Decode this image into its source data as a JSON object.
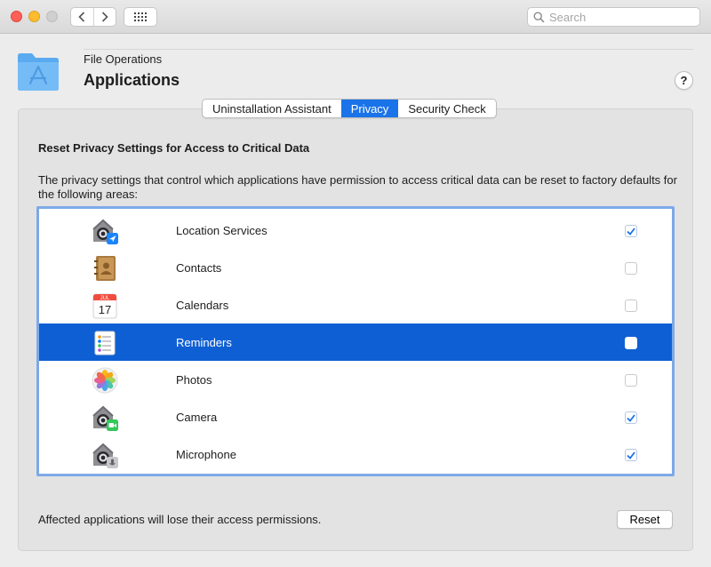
{
  "toolbar": {
    "back_icon": "chevron-left-icon",
    "forward_icon": "chevron-right-icon",
    "grid_icon": "grid-icon",
    "search_placeholder": "Search"
  },
  "header": {
    "breadcrumb": "File Operations",
    "title": "Applications",
    "help_label": "?"
  },
  "tabs": [
    {
      "label": "Uninstallation Assistant",
      "active": false
    },
    {
      "label": "Privacy",
      "active": true
    },
    {
      "label": "Security Check",
      "active": false
    }
  ],
  "privacy": {
    "section_title": "Reset Privacy Settings for Access to Critical Data",
    "description": "The privacy settings that control which applications have permission to access critical data can be reset to factory defaults for the following areas:",
    "items": [
      {
        "label": "Location Services",
        "icon": "location-services-icon",
        "checked": true,
        "selected": false
      },
      {
        "label": "Contacts",
        "icon": "contacts-icon",
        "checked": false,
        "selected": false
      },
      {
        "label": "Calendars",
        "icon": "calendar-icon",
        "checked": false,
        "selected": false
      },
      {
        "label": "Reminders",
        "icon": "reminders-icon",
        "checked": false,
        "selected": true
      },
      {
        "label": "Photos",
        "icon": "photos-icon",
        "checked": false,
        "selected": false
      },
      {
        "label": "Camera",
        "icon": "camera-icon",
        "checked": true,
        "selected": false
      },
      {
        "label": "Microphone",
        "icon": "microphone-icon",
        "checked": true,
        "selected": false
      }
    ],
    "calendar_month": "JUL",
    "calendar_day": "17",
    "footer_text": "Affected applications will lose their access permissions.",
    "reset_label": "Reset"
  },
  "colors": {
    "accent": "#1a73e8",
    "selection": "#0f5fd4",
    "checkbox_check": "#1a73e8"
  }
}
